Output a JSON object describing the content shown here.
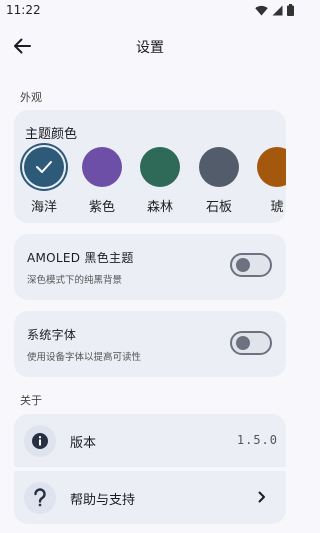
{
  "status_bar": {
    "time": "11:22"
  },
  "app_bar": {
    "title": "设置"
  },
  "appearance": {
    "section_label": "外观",
    "theme_color": {
      "title": "主题颜色",
      "swatches": [
        {
          "label": "海洋",
          "color": "#2e5a7a",
          "selected": true
        },
        {
          "label": "紫色",
          "color": "#6e4fa8",
          "selected": false
        },
        {
          "label": "森林",
          "color": "#2f6a58",
          "selected": false
        },
        {
          "label": "石板",
          "color": "#525c6a",
          "selected": false
        },
        {
          "label": "琥",
          "color": "#a4580e",
          "selected": false
        }
      ]
    },
    "amoled": {
      "title": "AMOLED 黑色主题",
      "subtitle": "深色模式下的纯黑背景",
      "enabled": false
    },
    "system_font": {
      "title": "系统字体",
      "subtitle": "使用设备字体以提高可读性",
      "enabled": false
    }
  },
  "about": {
    "section_label": "关于",
    "version": {
      "label": "版本",
      "value": "1.5.0",
      "icon": "info-icon"
    },
    "help": {
      "label": "帮助与支持",
      "icon": "help-icon"
    }
  }
}
